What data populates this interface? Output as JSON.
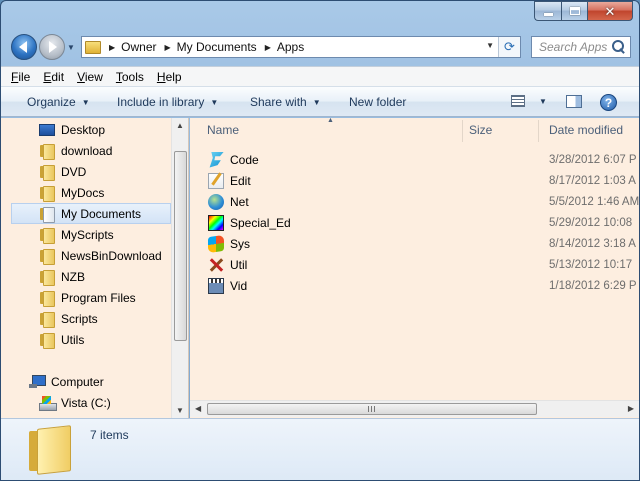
{
  "window": {
    "caption_buttons": {
      "close_glyph": "✕"
    }
  },
  "nav": {
    "breadcrumb": [
      "Owner",
      "My Documents",
      "Apps"
    ],
    "search_placeholder": "Search Apps",
    "icons": {
      "back": "back-arrow-icon",
      "forward": "forward-arrow-icon",
      "refresh": "refresh-icon",
      "search": "search-icon"
    }
  },
  "menubar": {
    "items": [
      {
        "accel": "F",
        "rest": "ile"
      },
      {
        "accel": "E",
        "rest": "dit"
      },
      {
        "accel": "V",
        "rest": "iew"
      },
      {
        "accel": "T",
        "rest": "ools"
      },
      {
        "accel": "H",
        "rest": "elp"
      }
    ]
  },
  "cmdbar": {
    "organize": "Organize",
    "include": "Include in library",
    "share": "Share with",
    "new_folder": "New folder",
    "help": "?"
  },
  "navpane": {
    "items": [
      {
        "label": "Desktop",
        "icon": "desktop-icon"
      },
      {
        "label": "download",
        "icon": "folder-icon"
      },
      {
        "label": "DVD",
        "icon": "folder-icon"
      },
      {
        "label": "MyDocs",
        "icon": "folder-icon"
      },
      {
        "label": "My Documents",
        "icon": "documents-folder-icon",
        "selected": true
      },
      {
        "label": "MyScripts",
        "icon": "folder-icon"
      },
      {
        "label": "NewsBinDownload",
        "icon": "folder-icon"
      },
      {
        "label": "NZB",
        "icon": "folder-icon"
      },
      {
        "label": "Program Files",
        "icon": "folder-icon"
      },
      {
        "label": "Scripts",
        "icon": "folder-icon"
      },
      {
        "label": "Utils",
        "icon": "folder-icon"
      }
    ],
    "computer": "Computer",
    "drive": "Vista (C:)"
  },
  "filelist": {
    "columns": {
      "name": "Name",
      "size": "Size",
      "date": "Date modified"
    },
    "rows": [
      {
        "name": "Code",
        "date": "3/28/2012 6:07 P",
        "icon": "code-icon"
      },
      {
        "name": "Edit",
        "date": "8/17/2012 1:03 A",
        "icon": "edit-icon"
      },
      {
        "name": "Net",
        "date": "5/5/2012 1:46 AM",
        "icon": "globe-icon"
      },
      {
        "name": "Special_Ed",
        "date": "5/29/2012 10:08",
        "icon": "special-ed-icon"
      },
      {
        "name": "Sys",
        "date": "8/14/2012 3:18 A",
        "icon": "windows-logo-icon"
      },
      {
        "name": "Util",
        "date": "5/13/2012 10:17",
        "icon": "tools-icon"
      },
      {
        "name": "Vid",
        "date": "1/18/2012 6:29 P",
        "icon": "clapperboard-icon"
      }
    ]
  },
  "details": {
    "count": "7 items"
  }
}
